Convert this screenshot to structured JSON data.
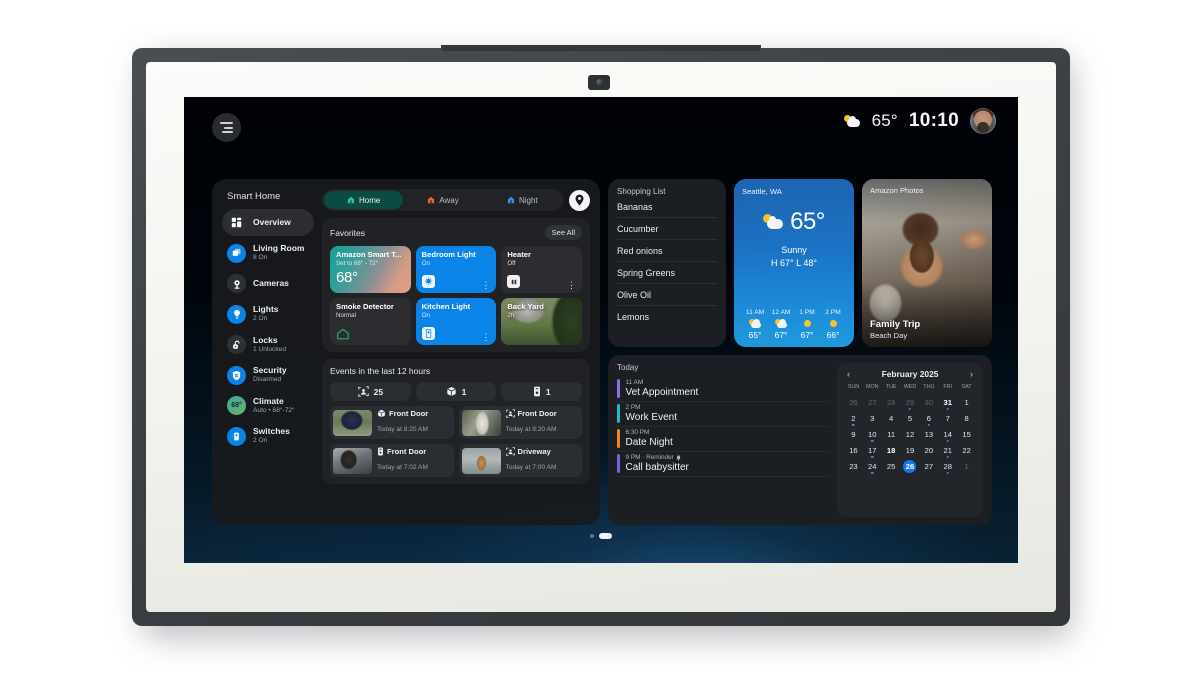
{
  "status_bar": {
    "menu_icon": "hamburger-menu-icon",
    "weather_icon": "sun-behind-cloud-icon",
    "temperature": "65°",
    "time": "10:10",
    "avatar": "user-avatar"
  },
  "smart_home": {
    "title": "Smart Home",
    "nav": [
      {
        "label": "Overview",
        "sub": "",
        "icon": "dashboard-icon",
        "active": true
      },
      {
        "label": "Living Room",
        "sub": "8 On",
        "icon": "rooms-icon",
        "active": false
      },
      {
        "label": "Cameras",
        "sub": "",
        "icon": "camera-icon",
        "active": false
      },
      {
        "label": "Lights",
        "sub": "2 On",
        "icon": "lightbulb-icon",
        "active": false
      },
      {
        "label": "Locks",
        "sub": "1 Unlocked",
        "icon": "lock-icon",
        "active": false
      },
      {
        "label": "Security",
        "sub": "Disarmed",
        "icon": "shield-icon",
        "active": false
      },
      {
        "label": "Climate",
        "sub": "Auto • 68°-72°",
        "icon": "thermostat-icon",
        "active": false
      },
      {
        "label": "Switches",
        "sub": "2 On",
        "icon": "switch-icon",
        "active": false
      }
    ],
    "climate_badge": "68°",
    "modes": [
      {
        "label": "Home",
        "icon": "house-green-icon",
        "selected": true
      },
      {
        "label": "Away",
        "icon": "house-orange-icon",
        "selected": false
      },
      {
        "label": "Night",
        "icon": "house-blue-icon",
        "selected": false
      }
    ],
    "location_button": "location-pin-button",
    "favorites": {
      "title": "Favorites",
      "see_all": "See All",
      "cards": [
        {
          "name": "Amazon Smart T...",
          "sub": "Set to 68° - 72°",
          "temp": "68°",
          "style": "thermostat"
        },
        {
          "name": "Bedroom Light",
          "sub": "On",
          "style": "light-on",
          "control": "lightbulb-icon"
        },
        {
          "name": "Heater",
          "sub": "Off",
          "style": "off",
          "control": "heater-icon"
        },
        {
          "name": "Smoke Detector",
          "sub": "Normal",
          "style": "off",
          "control": "smoke-home-icon"
        },
        {
          "name": "Kitchen Light",
          "sub": "On",
          "style": "light-on",
          "control": "switch-icon"
        },
        {
          "name": "Back Yard",
          "sub": "2h",
          "style": "camera"
        }
      ]
    },
    "events": {
      "title": "Events in the last 12 hours",
      "chips": [
        {
          "icon": "person-detected-icon",
          "count": "25"
        },
        {
          "icon": "package-detected-icon",
          "count": "1"
        },
        {
          "icon": "doorbell-press-icon",
          "count": "1"
        }
      ],
      "items": [
        {
          "icon": "package-detected-icon",
          "name": "Front Door",
          "time": "Today at 8:20 AM",
          "thumb": "ev-t1"
        },
        {
          "icon": "person-detected-icon",
          "name": "Front Door",
          "time": "Today at 8:20 AM",
          "thumb": "ev-t2"
        },
        {
          "icon": "doorbell-press-icon",
          "name": "Front Door",
          "time": "Today at 7:02 AM",
          "thumb": "ev-t3"
        },
        {
          "icon": "person-detected-icon",
          "name": "Driveway",
          "time": "Today at 7:00 AM",
          "thumb": "ev-t4"
        }
      ]
    }
  },
  "shopping_list": {
    "title": "Shopping List",
    "items": [
      "Bananas",
      "Cucumber",
      "Red onions",
      "Spring Greens",
      "Olive Oil",
      "Lemons"
    ]
  },
  "weather": {
    "city": "Seattle, WA",
    "icon": "sun-behind-cloud-icon",
    "temperature": "65°",
    "condition": "Sunny",
    "high_low": "H 67°  L 48°",
    "forecast": [
      {
        "hour": "11 AM",
        "icon": "sun-behind-cloud-icon",
        "temp": "65°"
      },
      {
        "hour": "12 AM",
        "icon": "sun-behind-cloud-icon",
        "temp": "67°"
      },
      {
        "hour": "1 PM",
        "icon": "sun-icon",
        "temp": "67°"
      },
      {
        "hour": "2 PM",
        "icon": "sun-icon",
        "temp": "66°"
      }
    ]
  },
  "photos": {
    "title": "Amazon Photos",
    "caption_title": "Family Trip",
    "caption_sub": "Beach Day"
  },
  "agenda": {
    "title": "Today",
    "events": [
      {
        "time": "11 AM",
        "name": "Vet Appointment",
        "color": "#8e6ee0"
      },
      {
        "time": "2 PM",
        "name": "Work Event",
        "color": "#22b8c4"
      },
      {
        "time": "6:30 PM",
        "name": "Date Night",
        "color": "#e8852c"
      },
      {
        "time": "9 PM · Reminder",
        "name": "Call babysitter",
        "color": "#7a63d8",
        "badge": "bell-icon"
      }
    ]
  },
  "calendar": {
    "month": "February 2025",
    "prev": "‹",
    "next": "›",
    "dow": [
      "SUN",
      "MON",
      "TUE",
      "WED",
      "THU",
      "FRI",
      "SAT"
    ],
    "selected_day": 26,
    "cells": [
      {
        "n": "26",
        "dim": true
      },
      {
        "n": "27",
        "dim": true
      },
      {
        "n": "28",
        "dim": true
      },
      {
        "n": "29",
        "dim": true,
        "dot": true
      },
      {
        "n": "30",
        "dim": true
      },
      {
        "n": "31",
        "dim": true,
        "bold": true,
        "dot": true
      },
      {
        "n": "1"
      },
      {
        "n": "2",
        "dot": true
      },
      {
        "n": "3"
      },
      {
        "n": "4"
      },
      {
        "n": "5"
      },
      {
        "n": "6",
        "dot": true
      },
      {
        "n": "7"
      },
      {
        "n": "8"
      },
      {
        "n": "9"
      },
      {
        "n": "10",
        "dot": true
      },
      {
        "n": "11"
      },
      {
        "n": "12"
      },
      {
        "n": "13"
      },
      {
        "n": "14",
        "dot": true
      },
      {
        "n": "15"
      },
      {
        "n": "16"
      },
      {
        "n": "17",
        "dot": true
      },
      {
        "n": "18",
        "bold": true
      },
      {
        "n": "19"
      },
      {
        "n": "20"
      },
      {
        "n": "21",
        "dot": true
      },
      {
        "n": "22"
      },
      {
        "n": "23"
      },
      {
        "n": "24",
        "dot": true
      },
      {
        "n": "25"
      },
      {
        "n": "26",
        "today": true
      },
      {
        "n": "27"
      },
      {
        "n": "28",
        "dot": true
      },
      {
        "n": "1",
        "dim": true
      }
    ]
  },
  "page_indicator": {
    "total": 2,
    "active": 2
  }
}
